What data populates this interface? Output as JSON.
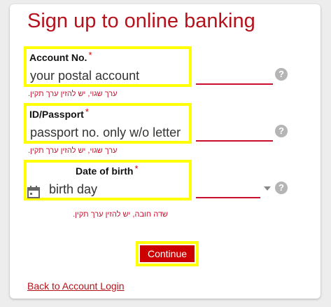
{
  "form": {
    "title": "Sign up to online banking",
    "account": {
      "label": "Account No.",
      "required_mark": "*",
      "value": "your postal account",
      "error": "ערך שגוי, יש להזין ערך תקין.",
      "help": "?"
    },
    "id": {
      "label": "ID/Passport",
      "required_mark": "*",
      "value": "passport no. only w/o letter",
      "error": "ערך שגוי, יש להזין ערך תקין.",
      "help": "?"
    },
    "dob": {
      "label": "Date of birth",
      "required_mark": "*",
      "value": "birth day",
      "error": "שדה חובה, יש להזין ערך תקין.",
      "help": "?"
    },
    "continue_label": "Continue",
    "back_link": "Back to Account Login"
  },
  "colors": {
    "accent": "#b5121b",
    "button": "#cc0000",
    "highlight": "#ffff00",
    "background": "#ededed"
  }
}
